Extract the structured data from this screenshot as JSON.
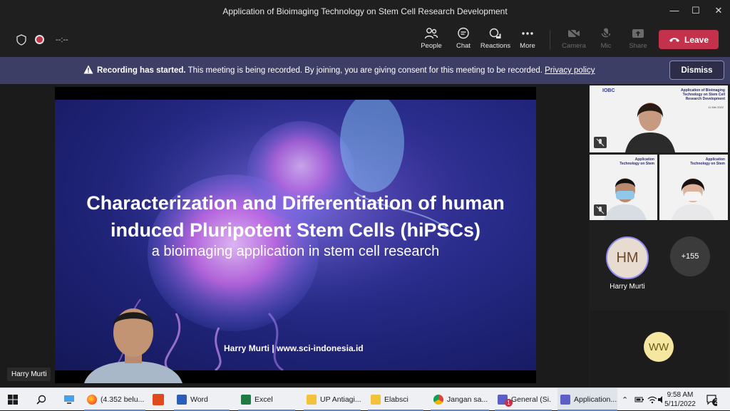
{
  "window": {
    "title": "Application of Bioimaging Technology on Stem Cell Research Development",
    "minimize_glyph": "—",
    "maximize_glyph": "☐",
    "close_glyph": "✕"
  },
  "toolbar": {
    "timer": "--:--",
    "people_label": "People",
    "chat_label": "Chat",
    "reactions_label": "Reactions",
    "more_label": "More",
    "camera_label": "Camera",
    "mic_label": "Mic",
    "share_label": "Share",
    "leave_label": "Leave"
  },
  "banner": {
    "bold_text": "Recording has started.",
    "text": " This meeting is being recorded. By joining, you are giving consent for this meeting to be recorded. ",
    "link": "Privacy policy",
    "dismiss_label": "Dismiss"
  },
  "slide": {
    "title_line1": "Characterization and Differentiation of human",
    "title_line2": "induced Pluripotent Stem Cells (hiPSCs)",
    "subtitle": "a bioimaging application in stem cell research",
    "footer": "Harry Murti | www.sci-indonesia.id"
  },
  "presenter": {
    "name": "Harry Murti"
  },
  "participants": {
    "tile1_header": "Application of Bioimaging Technology on Stem Cell Research Development",
    "tile1_date": "11 Mei 2022",
    "tile1_logo": "IOBC",
    "tile2_header": "Application Technology on Stem",
    "tile3_header": "Application Technology on Stem",
    "hm_initials": "HM",
    "hm_name": "Harry Murti",
    "overflow_count": "+155",
    "ww_initials": "WW"
  },
  "taskbar": {
    "firefox_label": "(4.352 belu...",
    "word_label": "Word",
    "excel_label": "Excel",
    "folder1_label": "UP Antiagi...",
    "folder2_label": "Elabsci",
    "chrome_label": "Jangan sa...",
    "teams_general_label": "General (Si...",
    "teams_app_label": "Application...",
    "teams_badge": "1",
    "time": "9:58 AM",
    "date": "5/11/2022",
    "notification_count": "2"
  },
  "colors": {
    "leave": "#c4314b",
    "banner": "#3d3e66",
    "hm_avatar": "#e8dcd0",
    "ww_avatar": "#f5e6a0",
    "overflow_circle": "#3b3b3b"
  }
}
